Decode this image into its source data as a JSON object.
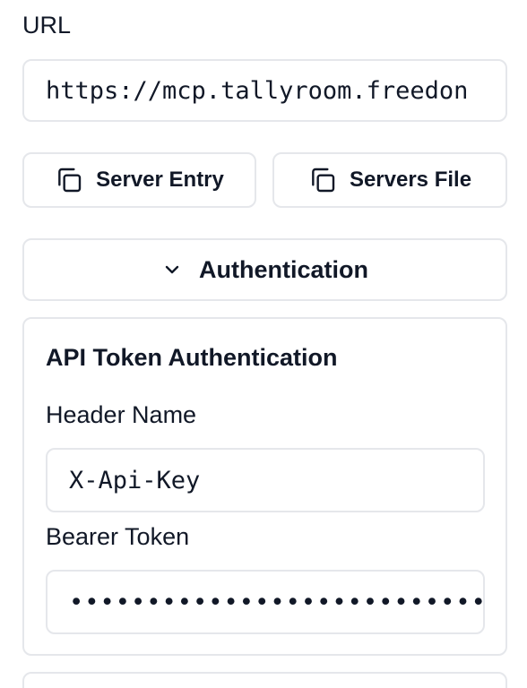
{
  "url": {
    "label": "URL",
    "value": "https://mcp.tallyroom.freedon"
  },
  "actions": {
    "server_entry": {
      "label": "Server Entry",
      "icon": "copy-icon"
    },
    "servers_file": {
      "label": "Servers File",
      "icon": "copy-icon"
    }
  },
  "auth_toggle": {
    "label": "Authentication",
    "icon": "chevron-down-icon"
  },
  "auth_panel": {
    "title": "API Token Authentication",
    "header_name": {
      "label": "Header Name",
      "value": "X-Api-Key"
    },
    "bearer_token": {
      "label": "Bearer Token",
      "value": "•••••••••••••••••••••••••••"
    }
  },
  "colors": {
    "border": "#e5e7eb",
    "text": "#111827",
    "background": "#ffffff"
  }
}
